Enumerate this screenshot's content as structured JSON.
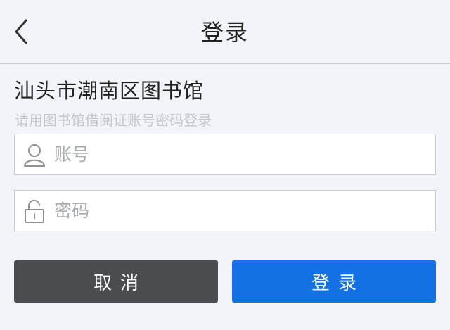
{
  "header": {
    "title": "登录",
    "back_icon": "chevron-left-icon"
  },
  "library": {
    "name": "汕头市潮南区图书馆",
    "hint": "请用图书馆借阅证账号密码登录"
  },
  "form": {
    "account": {
      "placeholder": "账号",
      "value": "",
      "icon": "user-icon"
    },
    "password": {
      "placeholder": "密码",
      "value": "",
      "icon": "unlock-icon"
    }
  },
  "buttons": {
    "cancel_label": "取消",
    "login_label": "登录"
  },
  "colors": {
    "background": "#f1f4f8",
    "cancel_button": "#4a4c50",
    "login_button": "#1272e3",
    "hint_text": "#c2c6cc"
  }
}
